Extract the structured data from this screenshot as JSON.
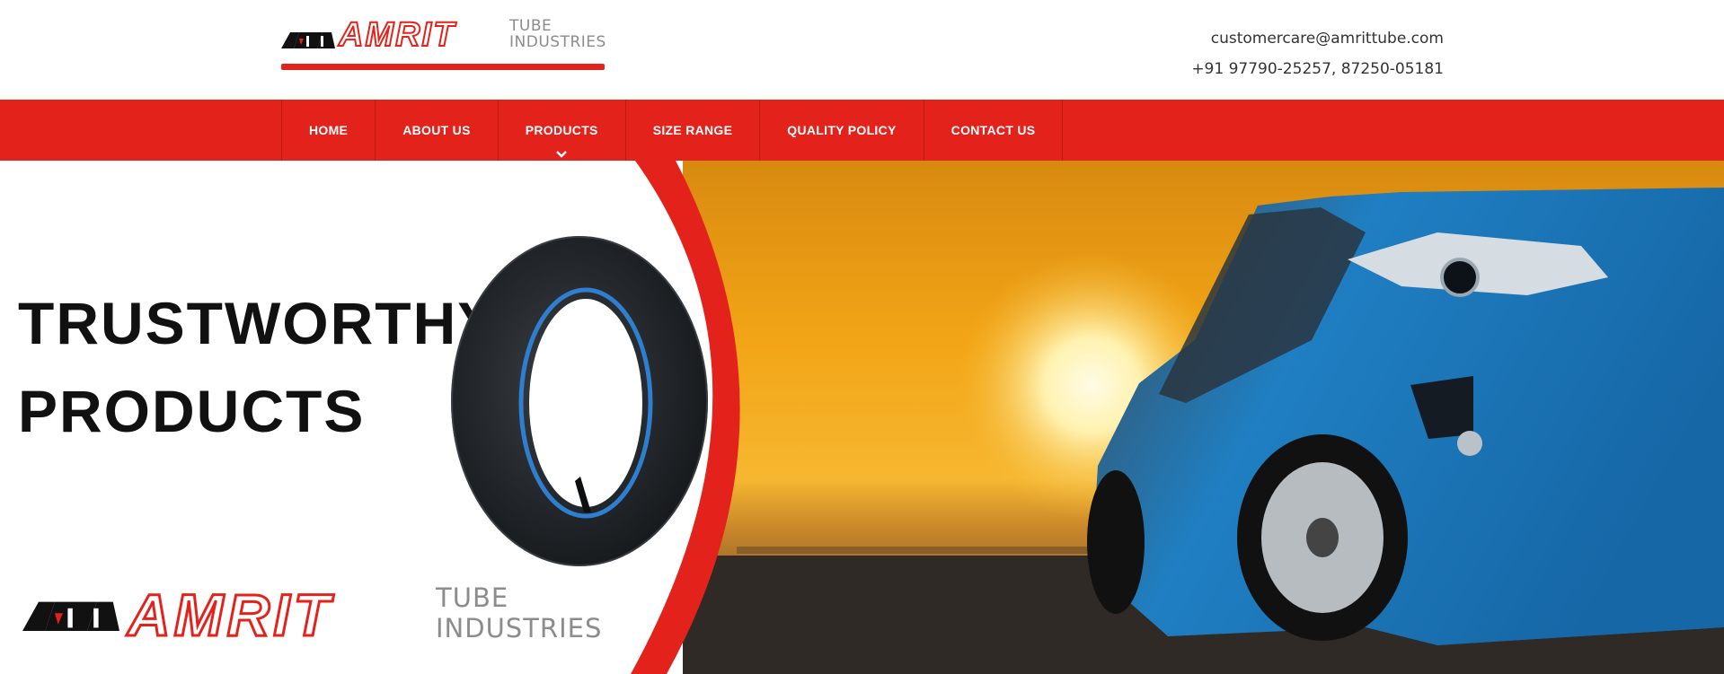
{
  "header": {
    "logo": {
      "brand": "AMRIT",
      "line1": "TUBE",
      "line2": "INDUSTRIES"
    },
    "email": "customercare@amrittube.com",
    "phone": "+91 97790-25257, 87250-05181"
  },
  "nav": {
    "items": [
      {
        "label": "HOME"
      },
      {
        "label": "ABOUT US"
      },
      {
        "label": "PRODUCTS"
      },
      {
        "label": "SIZE RANGE"
      },
      {
        "label": "QUALITY POLICY"
      },
      {
        "label": "CONTACT US"
      }
    ]
  },
  "hero": {
    "headline_line1": "TRUSTWORTHY",
    "headline_line2": "PRODUCTS",
    "logo": {
      "brand": "AMRIT",
      "line1": "TUBE",
      "line2": "INDUSTRIES"
    }
  },
  "colors": {
    "brand_red": "#e3231b",
    "gray": "#8c8c8c",
    "sunset": "#f2a516",
    "car_blue": "#1f7fc2"
  }
}
